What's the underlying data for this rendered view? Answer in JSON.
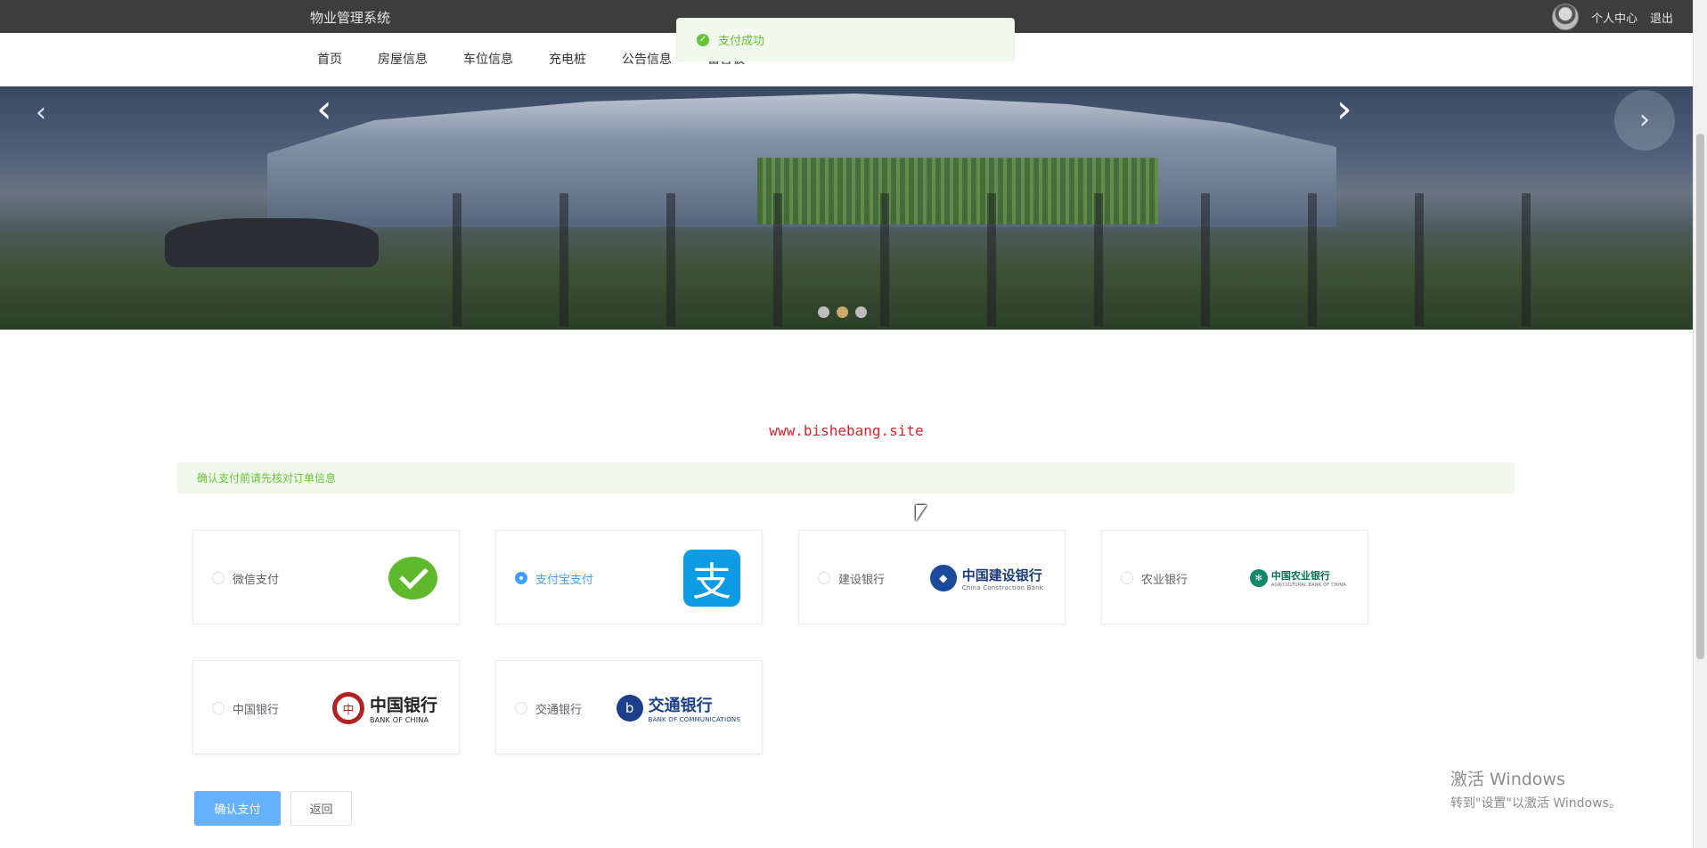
{
  "header": {
    "title": "物业管理系统",
    "user_center": "个人中心",
    "logout": "退出"
  },
  "nav": {
    "items": [
      "首页",
      "房屋信息",
      "车位信息",
      "充电桩",
      "公告信息",
      "留言板"
    ]
  },
  "toast": {
    "message": "支付成功",
    "icon": "check-circle-icon"
  },
  "banner": {
    "slide_count": 3,
    "active_index": 1
  },
  "site_watermark": "www.bishebang.site",
  "payment": {
    "notice": "确认支付前请先核对订单信息",
    "selected": "支付宝支付",
    "methods": [
      {
        "label": "微信支付",
        "logo": "wechat-logo"
      },
      {
        "label": "支付宝支付",
        "logo": "alipay-logo"
      },
      {
        "label": "建设银行",
        "logo": "ccb-logo",
        "logo_text": "中国建设银行",
        "logo_sub": "China Construction Bank"
      },
      {
        "label": "农业银行",
        "logo": "abc-logo",
        "logo_text": "中国农业银行",
        "logo_sub": "AGRICULTURAL BANK OF CHINA"
      },
      {
        "label": "中国银行",
        "logo": "boc-logo",
        "logo_text": "中国银行",
        "logo_sub": "BANK OF CHINA"
      },
      {
        "label": "交通银行",
        "logo": "bocom-logo",
        "logo_text": "交通银行",
        "logo_sub": "BANK OF COMMUNICATIONS"
      }
    ],
    "confirm_button": "确认支付",
    "back_button": "返回"
  },
  "windows_activation": {
    "line1": "激活 Windows",
    "line2": "转到\"设置\"以激活 Windows。"
  },
  "colors": {
    "accent": "#409eff",
    "success": "#67c23a",
    "topbar": "#3d3d3d",
    "watermark": "#d9232d"
  }
}
